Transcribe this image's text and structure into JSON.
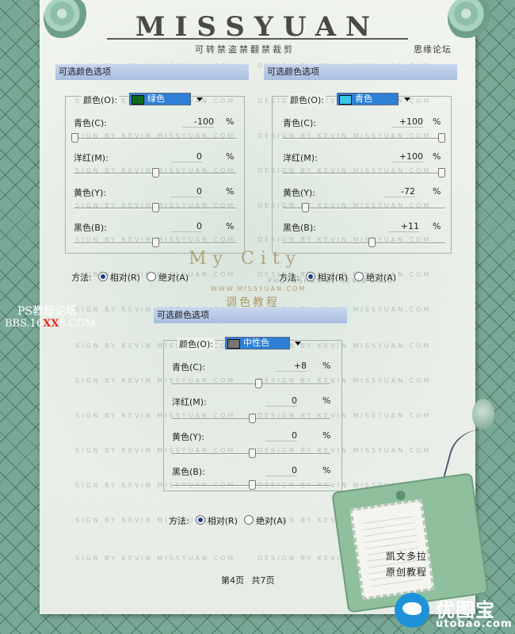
{
  "header": {
    "logo": "MISSYUAN",
    "subtitle": "可转禁盗禁翻禁裁剪",
    "forum": "思缘论坛"
  },
  "watermark": {
    "sign_text": "SIGN BY KEVIN MISSYUAN.COM",
    "design_text": "DESIGN BY KEVIN MISSYUAN.COM"
  },
  "panels": [
    {
      "title": "可选颜色选项",
      "color_label": "颜色(O):",
      "color_value": "绿色",
      "chip_color": "#0c6a1c",
      "rows": [
        {
          "label": "青色(C):",
          "value": "-100",
          "unit": "%",
          "slider": 0.0
        },
        {
          "label": "洋红(M):",
          "value": "0",
          "unit": "%",
          "slider": 0.5
        },
        {
          "label": "黄色(Y):",
          "value": "0",
          "unit": "%",
          "slider": 0.5
        },
        {
          "label": "黑色(B):",
          "value": "0",
          "unit": "%",
          "slider": 0.5
        }
      ],
      "method_label": "方法:",
      "method_relative": "相对(R)",
      "method_absolute": "绝对(A)",
      "method_selected": "relative"
    },
    {
      "title": "可选颜色选项",
      "color_label": "颜色(O):",
      "color_value": "青色",
      "chip_color": "#38c8e8",
      "rows": [
        {
          "label": "青色(C):",
          "value": "+100",
          "unit": "%",
          "slider": 1.0
        },
        {
          "label": "洋红(M):",
          "value": "+100",
          "unit": "%",
          "slider": 1.0
        },
        {
          "label": "黄色(Y):",
          "value": "-72",
          "unit": "%",
          "slider": 0.14
        },
        {
          "label": "黑色(B):",
          "value": "+11",
          "unit": "%",
          "slider": 0.555
        }
      ],
      "method_label": "方法:",
      "method_relative": "相对(R)",
      "method_absolute": "绝对(A)",
      "method_selected": "relative"
    },
    {
      "title": "可选颜色选项",
      "color_label": "颜色(O):",
      "color_value": "中性色",
      "chip_color": "#777777",
      "rows": [
        {
          "label": "青色(C):",
          "value": "+8",
          "unit": "%",
          "slider": 0.54
        },
        {
          "label": "洋红(M):",
          "value": "0",
          "unit": "%",
          "slider": 0.5
        },
        {
          "label": "黄色(Y):",
          "value": "0",
          "unit": "%",
          "slider": 0.5
        },
        {
          "label": "黑色(B):",
          "value": "0",
          "unit": "%",
          "slider": 0.5
        }
      ],
      "method_label": "方法:",
      "method_relative": "相对(R)",
      "method_absolute": "绝对(A)",
      "method_selected": "relative"
    }
  ],
  "center_text": {
    "my_city": "My City",
    "site": "WWW.MISSYUAN.COM",
    "photoshop_by": "PHOTOSHOP BY KEVIN 2010",
    "tutorial": "调色教程"
  },
  "side_watermark": {
    "ps_forum": "PS教程论坛",
    "bbs_prefix": "BBS.16",
    "bbs_xx": "XX",
    "bbs_suffix": "8.COM"
  },
  "pager": {
    "current": "第4页",
    "total": "共7页"
  },
  "tag": {
    "line1": "凯文多拉",
    "line2": "原创教程"
  },
  "brand": {
    "cn": "优图宝",
    "en": "utobao.com"
  }
}
